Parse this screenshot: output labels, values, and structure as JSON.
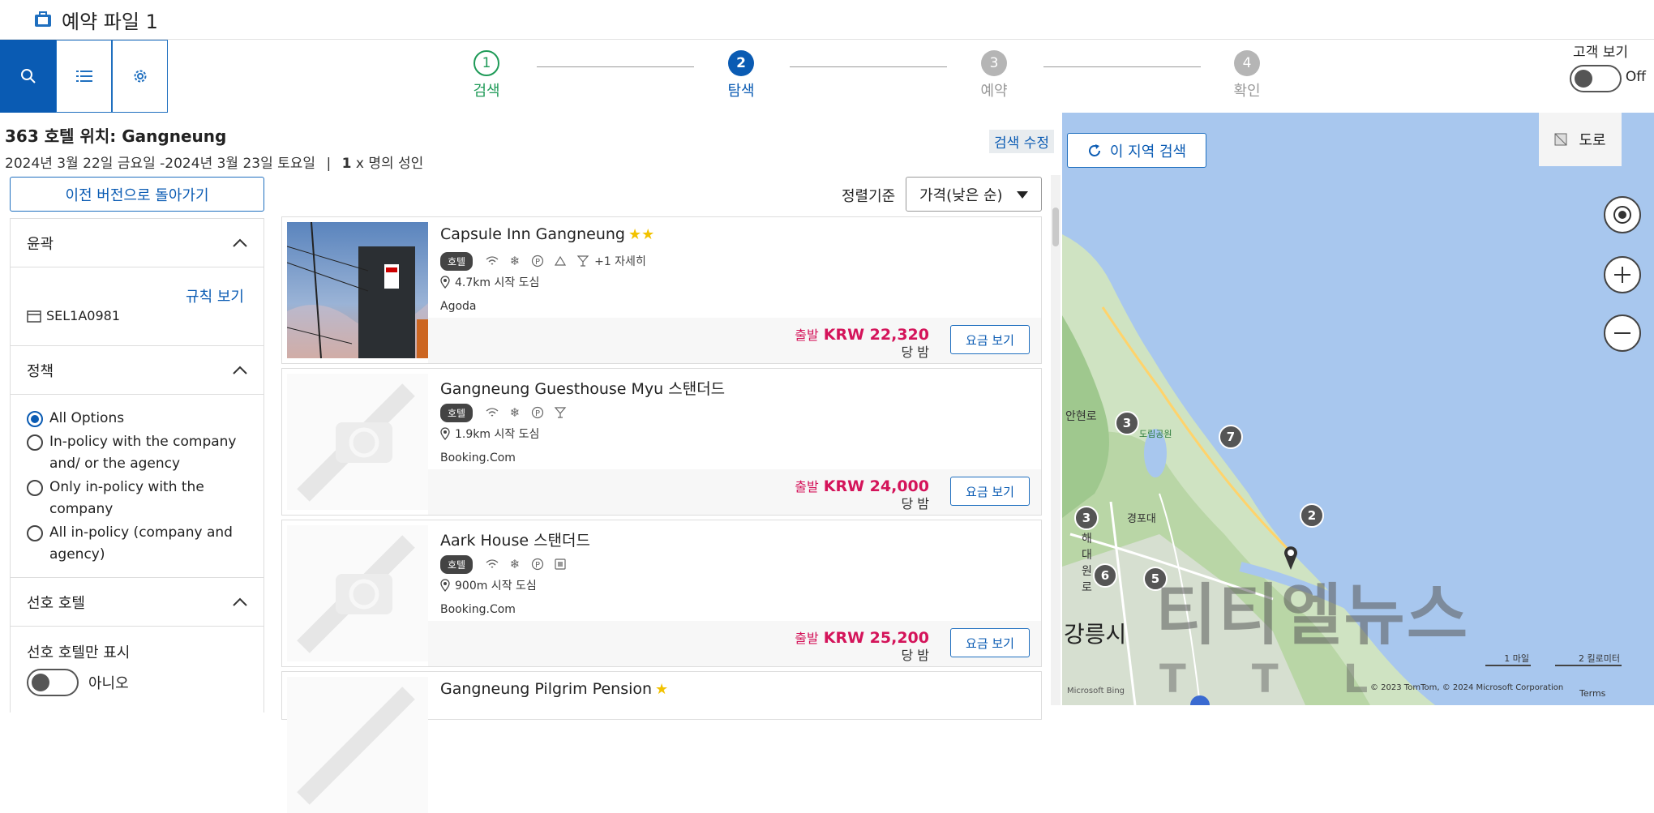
{
  "app": {
    "title": "예약 파일 1"
  },
  "steps": [
    {
      "num": "1",
      "label": "검색"
    },
    {
      "num": "2",
      "label": "탐색"
    },
    {
      "num": "3",
      "label": "예약"
    },
    {
      "num": "4",
      "label": "확인"
    }
  ],
  "customer_view": {
    "label": "고객 보기",
    "state": "Off"
  },
  "results": {
    "count": "363",
    "title_mid": "호텔 위치:",
    "city": "Gangneung",
    "dates": "2024년 3월 22일 금요일 -2024년 3월 23일 토요일",
    "sep": "|",
    "guests_num": "1",
    "guests_rest": "x 명의 성인",
    "edit": "검색 수정"
  },
  "back_button": "이전 버전으로 돌아가기",
  "filters": {
    "outline": {
      "title": "윤곽",
      "rules_link": "규칙 보기",
      "code": "SEL1A0981"
    },
    "policy": {
      "title": "정책",
      "options": [
        "All Options",
        "In-policy with the company and/ or the agency",
        "Only in-policy with the company",
        "All in-policy (company and agency)"
      ]
    },
    "preferred": {
      "title": "선호 호텔",
      "only_label": "선호 호텔만 표시",
      "toggle_value": "아니오"
    }
  },
  "sort": {
    "label": "정렬기준",
    "value": "가격(낮은 순)"
  },
  "hotels": [
    {
      "name": "Capsule Inn Gangneung",
      "stars": "★★",
      "badge": "호텔",
      "extra": "+1 자세히",
      "distance": "4.7km 시작 도심",
      "provider": "Agoda",
      "from": "출발",
      "price": "KRW 22,320",
      "per": "당 밤",
      "button": "요금 보기"
    },
    {
      "name": "Gangneung Guesthouse Myu 스탠더드",
      "stars": "",
      "badge": "호텔",
      "extra": "",
      "distance": "1.9km 시작 도심",
      "provider": "Booking.Com",
      "from": "출발",
      "price": "KRW 24,000",
      "per": "당 밤",
      "button": "요금 보기"
    },
    {
      "name": "Aark House 스탠더드",
      "stars": "",
      "badge": "호텔",
      "extra": "",
      "distance": "900m 시작 도심",
      "provider": "Booking.Com",
      "from": "출발",
      "price": "KRW 25,200",
      "per": "당 밤",
      "button": "요금 보기"
    },
    {
      "name": "Gangneung Pilgrim Pension",
      "stars": "★"
    }
  ],
  "map": {
    "search_area": "이 지역 검색",
    "road": "도로",
    "pins": [
      "3",
      "7",
      "3",
      "2",
      "6",
      "5"
    ],
    "city_label": "강릉시",
    "labels": [
      "안현로",
      "경포대",
      "해",
      "대",
      "원",
      "로",
      "도립공원"
    ],
    "scale_mile": "1 마일",
    "scale_km": "2 킬로미터",
    "attribution": "© 2023 TomTom, © 2024 Microsoft Corporation",
    "terms": "Terms",
    "bing": "Microsoft Bing"
  },
  "watermark": {
    "main": "티티엘뉴스",
    "sub": "TTL"
  },
  "colors": {
    "primary": "#0a5bb3",
    "step_done": "#1e9a57",
    "price": "#d4145a",
    "map_water": "#a8c7ee"
  }
}
